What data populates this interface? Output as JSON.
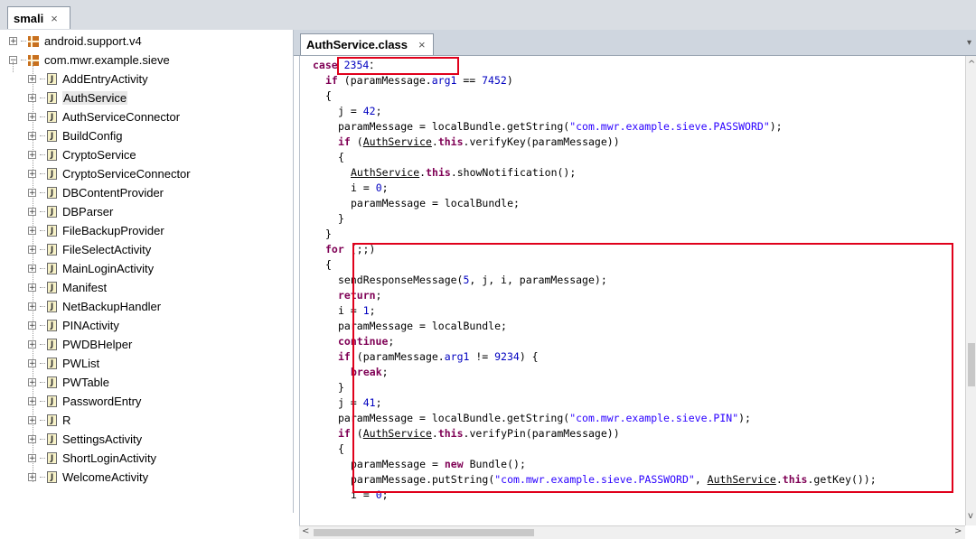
{
  "top_tab": {
    "label": "smali",
    "close": "×"
  },
  "tree": {
    "packages": [
      {
        "label": "android.support.v4",
        "expander": "+"
      },
      {
        "label": "com.mwr.example.sieve",
        "expander": "−"
      }
    ],
    "classes": [
      "AddEntryActivity",
      "AuthService",
      "AuthServiceConnector",
      "BuildConfig",
      "CryptoService",
      "CryptoServiceConnector",
      "DBContentProvider",
      "DBParser",
      "FileBackupProvider",
      "FileSelectActivity",
      "MainLoginActivity",
      "Manifest",
      "NetBackupHandler",
      "PINActivity",
      "PWDBHelper",
      "PWList",
      "PWTable",
      "PasswordEntry",
      "R",
      "SettingsActivity",
      "ShortLoginActivity",
      "WelcomeActivity"
    ],
    "selected": "AuthService",
    "class_icon_glyph": "J",
    "expander_glyph": "+"
  },
  "editor": {
    "tab_label": "AuthService.class",
    "tab_close": "×",
    "lines": [
      {
        "i": 2,
        "t": [
          [
            "kw",
            "case "
          ],
          [
            "num",
            "2354"
          ],
          [
            "",
            "："
          ]
        ]
      },
      {
        "i": 3,
        "t": [
          [
            "kw",
            "if"
          ],
          [
            "",
            " (paramMessage."
          ],
          [
            "fld",
            "arg1"
          ],
          [
            "",
            " == "
          ],
          [
            "num",
            "7452"
          ],
          [
            "",
            ")"
          ]
        ]
      },
      {
        "i": 3,
        "t": [
          [
            "",
            "{"
          ]
        ]
      },
      {
        "i": 4,
        "t": [
          [
            "",
            "j = "
          ],
          [
            "num",
            "42"
          ],
          [
            "",
            ";"
          ]
        ]
      },
      {
        "i": 4,
        "t": [
          [
            "",
            "paramMessage = localBundle.getString("
          ],
          [
            "str",
            "\"com.mwr.example.sieve.PASSWORD\""
          ],
          [
            "",
            ");"
          ]
        ]
      },
      {
        "i": 4,
        "t": [
          [
            "kw",
            "if"
          ],
          [
            "",
            " ("
          ],
          [
            "cls",
            "AuthService"
          ],
          [
            "",
            "."
          ],
          [
            "kw",
            "this"
          ],
          [
            "",
            ".verifyKey(paramMessage))"
          ]
        ]
      },
      {
        "i": 4,
        "t": [
          [
            "",
            "{"
          ]
        ]
      },
      {
        "i": 5,
        "t": [
          [
            "cls",
            "AuthService"
          ],
          [
            "",
            "."
          ],
          [
            "kw",
            "this"
          ],
          [
            "",
            ".showNotification();"
          ]
        ]
      },
      {
        "i": 5,
        "t": [
          [
            "",
            "i = "
          ],
          [
            "num",
            "0"
          ],
          [
            "",
            ";"
          ]
        ]
      },
      {
        "i": 5,
        "t": [
          [
            "",
            "paramMessage = localBundle;"
          ]
        ]
      },
      {
        "i": 4,
        "t": [
          [
            "",
            "}"
          ]
        ]
      },
      {
        "i": 3,
        "t": [
          [
            "",
            "}"
          ]
        ]
      },
      {
        "i": 3,
        "t": [
          [
            "kw",
            "for"
          ],
          [
            "",
            " (;;)"
          ]
        ]
      },
      {
        "i": 3,
        "t": [
          [
            "",
            "{"
          ]
        ]
      },
      {
        "i": 4,
        "t": [
          [
            "",
            "sendResponseMessage("
          ],
          [
            "num",
            "5"
          ],
          [
            "",
            ", j, i, paramMessage);"
          ]
        ]
      },
      {
        "i": 4,
        "t": [
          [
            "kw",
            "return"
          ],
          [
            "",
            ";"
          ]
        ]
      },
      {
        "i": 4,
        "t": [
          [
            "",
            "i = "
          ],
          [
            "num",
            "1"
          ],
          [
            "",
            ";"
          ]
        ]
      },
      {
        "i": 4,
        "t": [
          [
            "",
            "paramMessage = localBundle;"
          ]
        ]
      },
      {
        "i": 4,
        "t": [
          [
            "kw",
            "continue"
          ],
          [
            "",
            ";"
          ]
        ]
      },
      {
        "i": 4,
        "t": [
          [
            "kw",
            "if"
          ],
          [
            "",
            " (paramMessage."
          ],
          [
            "fld",
            "arg1"
          ],
          [
            "",
            " != "
          ],
          [
            "num",
            "9234"
          ],
          [
            "",
            ") {"
          ]
        ]
      },
      {
        "i": 5,
        "t": [
          [
            "kw",
            "break"
          ],
          [
            "",
            ";"
          ]
        ]
      },
      {
        "i": 4,
        "t": [
          [
            "",
            "}"
          ]
        ]
      },
      {
        "i": 4,
        "t": [
          [
            "",
            "j = "
          ],
          [
            "num",
            "41"
          ],
          [
            "",
            ";"
          ]
        ]
      },
      {
        "i": 4,
        "t": [
          [
            "",
            "paramMessage = localBundle.getString("
          ],
          [
            "str",
            "\"com.mwr.example.sieve.PIN\""
          ],
          [
            "",
            ");"
          ]
        ]
      },
      {
        "i": 4,
        "t": [
          [
            "kw",
            "if"
          ],
          [
            "",
            " ("
          ],
          [
            "cls",
            "AuthService"
          ],
          [
            "",
            "."
          ],
          [
            "kw",
            "this"
          ],
          [
            "",
            ".verifyPin(paramMessage))"
          ]
        ]
      },
      {
        "i": 4,
        "t": [
          [
            "",
            "{"
          ]
        ]
      },
      {
        "i": 5,
        "t": [
          [
            "",
            "paramMessage = "
          ],
          [
            "kw",
            "new"
          ],
          [
            "",
            " Bundle();"
          ]
        ]
      },
      {
        "i": 5,
        "t": [
          [
            "",
            "paramMessage.putString("
          ],
          [
            "str",
            "\"com.mwr.example.sieve.PASSWORD\""
          ],
          [
            "",
            ", "
          ],
          [
            "cls",
            "AuthService"
          ],
          [
            "",
            "."
          ],
          [
            "kw",
            "this"
          ],
          [
            "",
            ".getKey());"
          ]
        ]
      },
      {
        "i": 5,
        "t": [
          [
            "",
            "i = "
          ],
          [
            "num",
            "0"
          ],
          [
            "",
            ";"
          ]
        ]
      }
    ]
  },
  "scroll": {
    "up": "^",
    "down": "v",
    "left": "<",
    "right": ">"
  },
  "colors": {
    "highlight": "#e0001b",
    "keyword": "#7f0055",
    "string": "#2a00ff",
    "number": "#0000c0"
  }
}
